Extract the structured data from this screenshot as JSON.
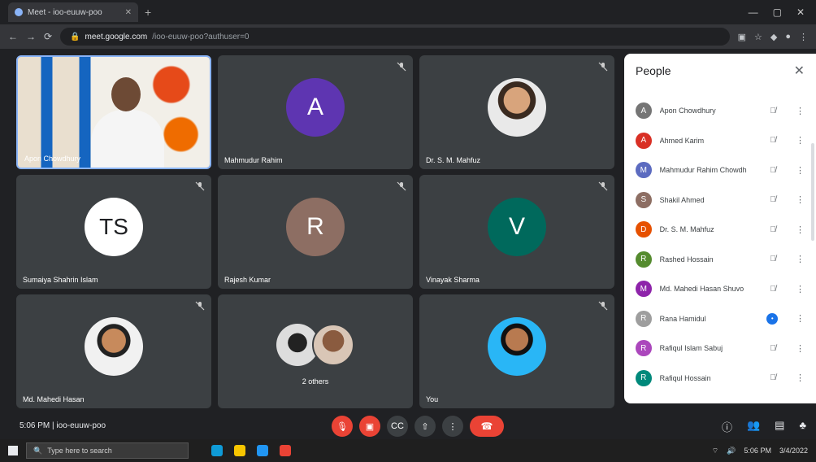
{
  "browser": {
    "tab_title": "Meet - ioo-euuw-poo",
    "url_host": "meet.google.com",
    "url_path": "/ioo-euuw-poo?authuser=0"
  },
  "tiles": [
    {
      "name": "Apon Chowdhury",
      "type": "video"
    },
    {
      "name": "Mahmudur Rahim",
      "type": "letter",
      "initials": "A",
      "color": "#5e35b1"
    },
    {
      "name": "Dr. S. M. Mahfuz",
      "type": "photo",
      "photo": "photo"
    },
    {
      "name": "Sumaiya Shahrin Islam",
      "type": "letter",
      "initials": "TS",
      "color": "#ffffff",
      "text_color": "#202124"
    },
    {
      "name": "Rajesh Kumar",
      "type": "letter",
      "initials": "R",
      "color": "#8d6e63"
    },
    {
      "name": "Vinayak Sharma",
      "type": "letter",
      "initials": "V",
      "color": "#00695c"
    },
    {
      "name": "Md. Mahedi Hasan",
      "type": "photo",
      "photo": "photo2"
    },
    {
      "name": "2 others",
      "type": "double"
    },
    {
      "name": "You",
      "type": "photo",
      "photo": "photo3"
    }
  ],
  "panel": {
    "title": "People",
    "people": [
      {
        "name": "Apon Chowdhury",
        "initial": "A",
        "color": "#757575",
        "icon": "mic-off"
      },
      {
        "name": "Ahmed Karim",
        "initial": "A",
        "color": "#d93025",
        "icon": "mic-off"
      },
      {
        "name": "Mahmudur Rahim Chowdhury",
        "initial": "M",
        "color": "#5c6bc0",
        "icon": "mic-off"
      },
      {
        "name": "Shakil Ahmed",
        "initial": "S",
        "color": "#8d6e63",
        "icon": "mic-off"
      },
      {
        "name": "Dr. S. M. Mahfuz",
        "initial": "D",
        "color": "#e65100",
        "icon": "mic-off"
      },
      {
        "name": "Rashed Hossain",
        "initial": "R",
        "color": "#558b2f",
        "icon": "mic-off"
      },
      {
        "name": "Md. Mahedi Hasan Shuvo",
        "initial": "M",
        "color": "#8e24aa",
        "icon": "mic-off"
      },
      {
        "name": "Rana Hamidul",
        "initial": "R",
        "color": "#9e9e9e",
        "icon": "blue-mic"
      },
      {
        "name": "Rafiqul Islam Sabuj",
        "initial": "R",
        "color": "#ab47bc",
        "icon": "mic-off"
      },
      {
        "name": "Rafiqul Hossain",
        "initial": "R",
        "color": "#00897b",
        "icon": "mic-off"
      }
    ]
  },
  "controls": {
    "time": "5:06 PM",
    "separator": "|",
    "meeting_code": "ioo-euuw-poo"
  },
  "taskbar": {
    "search_placeholder": "Type here to search",
    "time": "5:06 PM",
    "date": "3/4/2022"
  }
}
